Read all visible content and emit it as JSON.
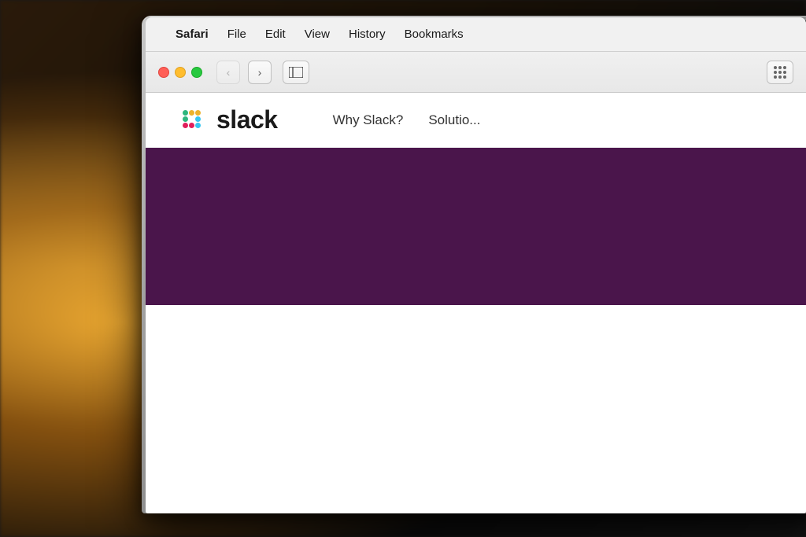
{
  "background": {
    "description": "Warm bokeh light background with laptop"
  },
  "menu_bar": {
    "apple_symbol": "",
    "items": [
      {
        "label": "Safari",
        "bold": true
      },
      {
        "label": "File",
        "bold": false
      },
      {
        "label": "Edit",
        "bold": false
      },
      {
        "label": "View",
        "bold": false
      },
      {
        "label": "History",
        "bold": false
      },
      {
        "label": "Bookmarks",
        "bold": false
      }
    ]
  },
  "browser": {
    "nav": {
      "back_icon": "‹",
      "forward_icon": "›",
      "sidebar_icon": "⊡"
    }
  },
  "slack_page": {
    "logo_text": "slack",
    "nav_links": [
      {
        "label": "Why Slack?"
      },
      {
        "label": "Solutio..."
      }
    ],
    "hero_color": "#4a154b"
  }
}
